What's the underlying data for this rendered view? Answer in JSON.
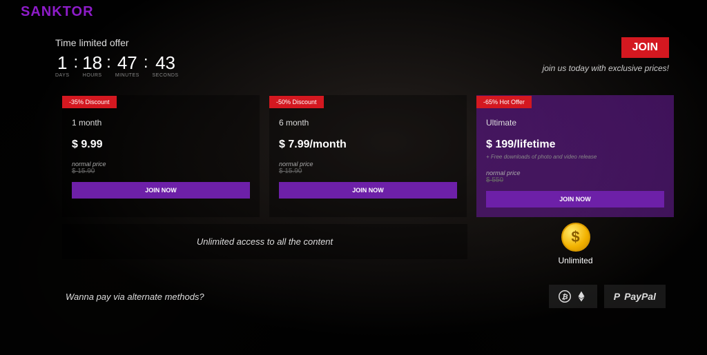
{
  "logo": "SANKTOR",
  "offer": {
    "title": "Time limited offer",
    "countdown": {
      "days": "1",
      "days_lbl": "DAYS",
      "hours": "18",
      "hours_lbl": "HOURS",
      "minutes": "47",
      "minutes_lbl": "MINUTES",
      "seconds": "43",
      "seconds_lbl": "SECONDS"
    },
    "join_label": "JOIN",
    "join_sub": "join us today with exclusive prices!"
  },
  "plans": [
    {
      "badge": "-35% Discount",
      "name": "1 month",
      "price": "$ 9.99",
      "sub": "",
      "normal_lbl": "normal price",
      "normal_val": "$ 15.90",
      "cta": "JOIN NOW"
    },
    {
      "badge": "-50% Discount",
      "name": "6 month",
      "price": "$ 7.99/month",
      "sub": "",
      "normal_lbl": "normal price",
      "normal_val": "$ 15.90",
      "cta": "JOIN NOW"
    },
    {
      "badge": "-65% Hot Offer",
      "name": "Ultimate",
      "price": "$ 199/lifetime",
      "sub": "+ Free downloads of photo and video release",
      "normal_lbl": "normal price",
      "normal_val": "$ 550",
      "cta": "JOIN NOW"
    }
  ],
  "unlimited_text": "Unlimited access to all the content",
  "unlimited_lbl": "Unlimited",
  "footer": {
    "text": "Wanna pay via alternate methods?",
    "paypal": "PayPal"
  }
}
